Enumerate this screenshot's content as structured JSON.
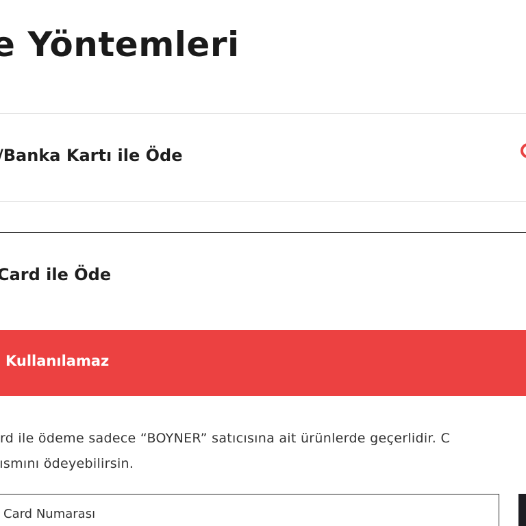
{
  "page": {
    "title": "e Yöntemleri"
  },
  "payment_options": [
    {
      "label": "/Banka Kartı ile Öde"
    },
    {
      "label": "Card ile Öde"
    }
  ],
  "warning": {
    "text": "Kullanılamaz",
    "color": "#ec4141"
  },
  "info": {
    "line1": "ard ile ödeme sadece “BOYNER” satıcısına ait ürünlerde geçerlidir. C",
    "line2": "kısmını ödeyebilirsin."
  },
  "card_input": {
    "placeholder": "Card Numarası"
  },
  "colors": {
    "accent": "#e84343",
    "text": "#1f1f1f",
    "button": "#1d1d22"
  }
}
